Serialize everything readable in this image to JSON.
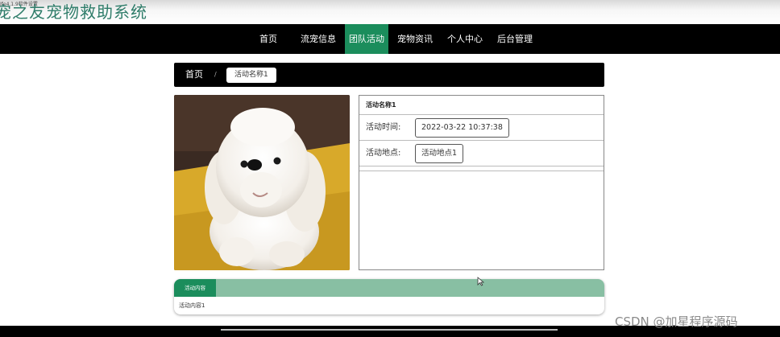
{
  "window": {
    "tiny_label": "Ife4.1.9软件设置",
    "site_title": "宠之友宠物救助系统"
  },
  "nav": {
    "items": [
      {
        "label": "首页",
        "active": false
      },
      {
        "label": "流宠信息",
        "active": false
      },
      {
        "label": "团队活动",
        "active": true
      },
      {
        "label": "宠物资讯",
        "active": false
      },
      {
        "label": "个人中心",
        "active": false
      },
      {
        "label": "后台管理",
        "active": false
      }
    ]
  },
  "breadcrumb": {
    "home": "首页",
    "separator": "/",
    "current": "活动名称1"
  },
  "photo": {
    "subject": "white-poodle-puppy"
  },
  "detail": {
    "title": "活动名称1",
    "time_label": "活动时间:",
    "time_value": "2022-03-22 10:37:38",
    "place_label": "活动地点:",
    "place_value": "活动地点1"
  },
  "content": {
    "tab_label": "活动内容",
    "body": "活动内容1"
  },
  "watermark": "CSDN @加星程序源码",
  "colors": {
    "accent": "#1b8d5c",
    "accent_light": "#88bfa3",
    "nav_bg": "#000000"
  }
}
